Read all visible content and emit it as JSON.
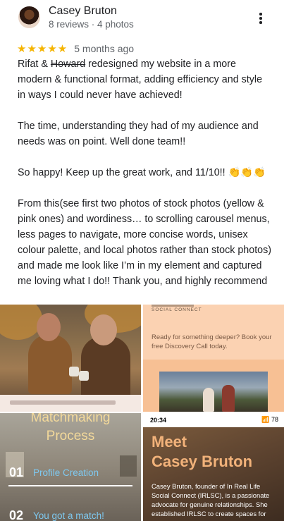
{
  "reviewer": {
    "name": "Casey Bruton",
    "meta": "8 reviews · 4 photos"
  },
  "rating": {
    "stars": "★★★★★",
    "value": 5,
    "time_ago": "5 months ago"
  },
  "review": {
    "p1_a": "Rifat & ",
    "p1_strike": "Howard",
    "p1_b": " redesigned my website in a more modern & functional format, adding efficiency and style in ways I could never have achieved!",
    "p2": "The time, understanding they had of my audience and needs was on point. Well done team!!",
    "p3": "So happy! Keep up the great work, and 11/10!! 👏👏👏",
    "p4": "From this(see first two photos of stock photos (yellow & pink ones) and wordiness… to scrolling carousel menus, less pages to navigate, more concise words, unisex colour palette, and local photos rather than stock photos) and made me look like I’m in my element and captured me loving what I do!! Thank you, and highly recommend"
  },
  "photos": {
    "photo2": {
      "brand": "SOCIAL CONNECT",
      "text": "Ready for something deeper? Book your free Discovery Call today."
    },
    "photo3": {
      "title1": "Matchmaking",
      "title2": "Process",
      "step1_num": "01",
      "step1_label": "Profile Creation",
      "step2_num": "02",
      "step2_label": "You got a match!"
    },
    "photo4": {
      "time": "20:34",
      "status_icons": "📶 78",
      "heading1": "Meet",
      "heading2": "Casey Bruton",
      "body": "Casey Bruton, founder of In Real Life Social Connect (IRLSC), is a passionate advocate for genuine relationships. She established IRLSC to create spaces for"
    }
  },
  "icons": {
    "more": "more-vert-icon"
  },
  "colors": {
    "star": "#f5b400",
    "secondary_text": "#5f6368"
  }
}
